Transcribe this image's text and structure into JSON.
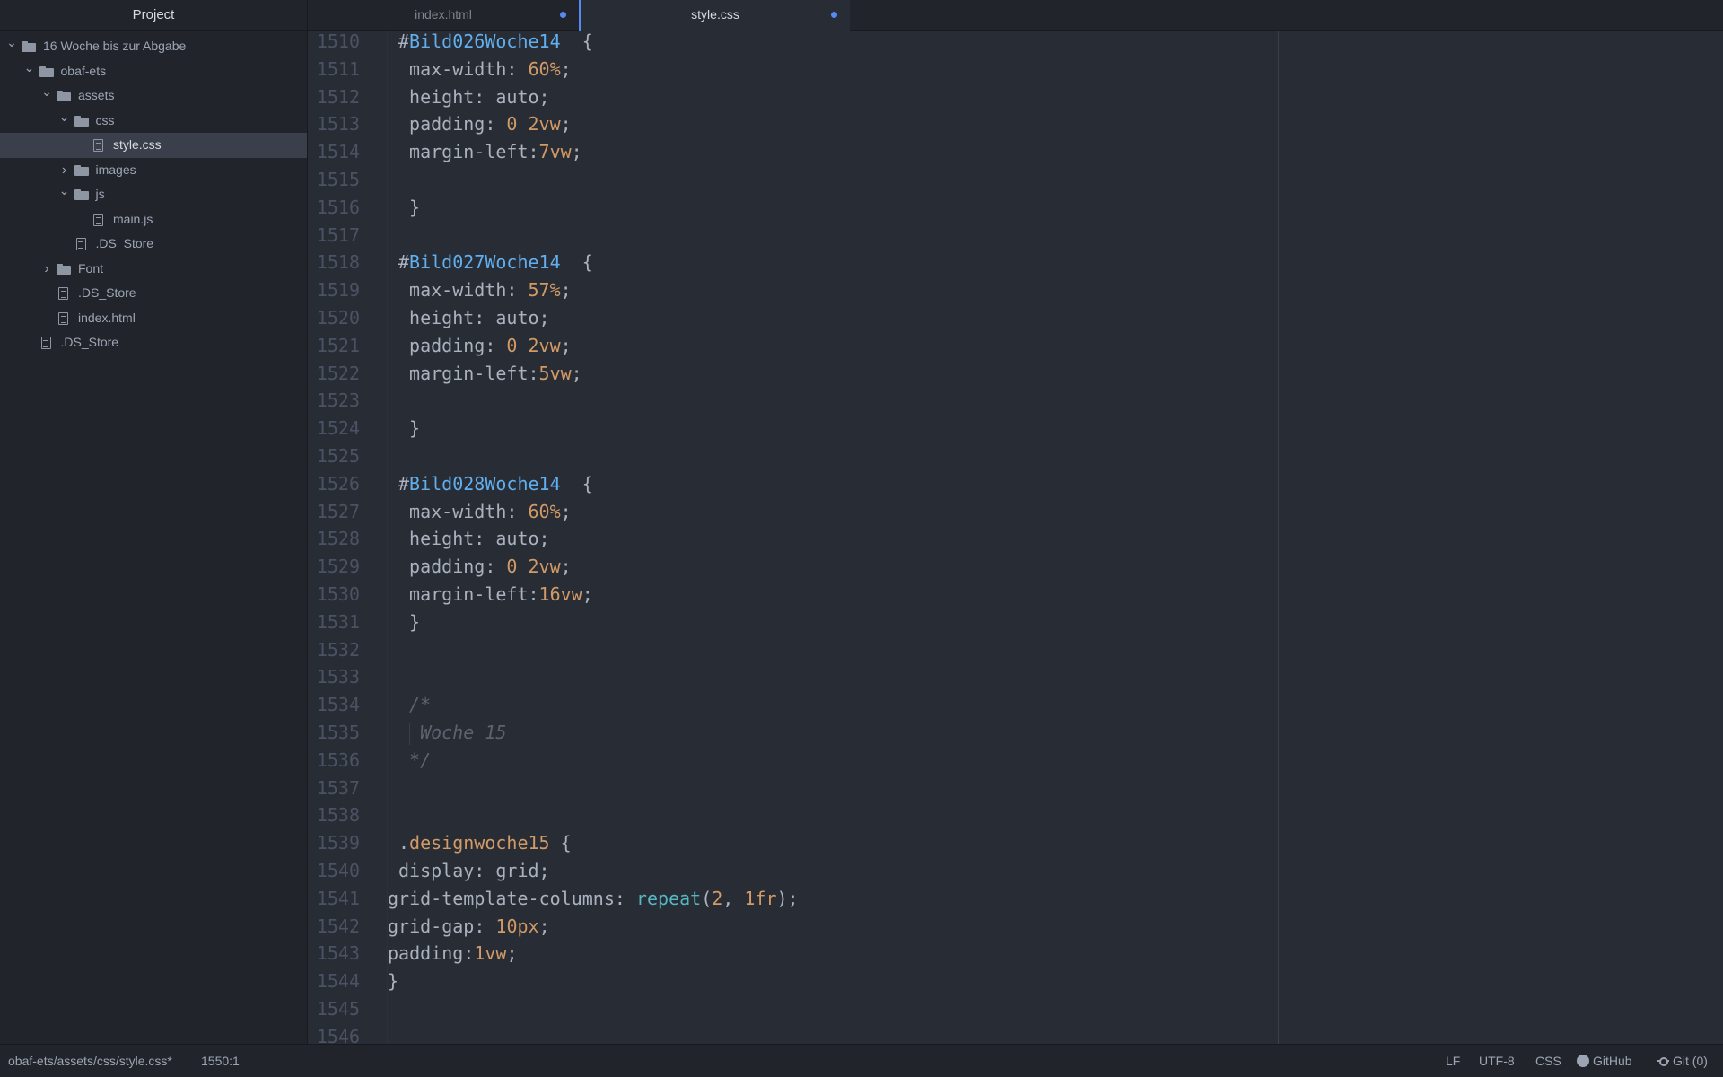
{
  "sidebar": {
    "title": "Project",
    "items": [
      {
        "label": "16 Woche bis zur Abgabe",
        "kind": "folder",
        "expanded": true,
        "depth": 0
      },
      {
        "label": "obaf-ets",
        "kind": "folder",
        "expanded": true,
        "depth": 1
      },
      {
        "label": "assets",
        "kind": "folder",
        "expanded": true,
        "depth": 2
      },
      {
        "label": "css",
        "kind": "folder",
        "expanded": true,
        "depth": 3
      },
      {
        "label": "style.css",
        "kind": "file",
        "depth": 4,
        "selected": true
      },
      {
        "label": "images",
        "kind": "folder",
        "expanded": false,
        "depth": 3
      },
      {
        "label": "js",
        "kind": "folder",
        "expanded": true,
        "depth": 3
      },
      {
        "label": "main.js",
        "kind": "file",
        "depth": 4
      },
      {
        "label": ".DS_Store",
        "kind": "file",
        "depth": 3
      },
      {
        "label": "Font",
        "kind": "folder",
        "expanded": false,
        "depth": 2
      },
      {
        "label": ".DS_Store",
        "kind": "file",
        "depth": 2
      },
      {
        "label": "index.html",
        "kind": "file",
        "depth": 2
      },
      {
        "label": ".DS_Store",
        "kind": "file",
        "depth": 1
      }
    ]
  },
  "tabs": [
    {
      "label": "index.html",
      "modified": true,
      "active": false
    },
    {
      "label": "style.css",
      "modified": true,
      "active": true
    }
  ],
  "editor": {
    "lines": [
      {
        "n": "1510",
        "tokens": [
          [
            "hash",
            "#"
          ],
          [
            "id",
            "Bild026Woche14"
          ],
          [
            "plain",
            "  {"
          ]
        ]
      },
      {
        "n": "1511",
        "tokens": [
          [
            "plain",
            " max-width: "
          ],
          [
            "num",
            "60%"
          ],
          [
            "plain",
            ";"
          ]
        ]
      },
      {
        "n": "1512",
        "tokens": [
          [
            "plain",
            " height: auto;"
          ]
        ]
      },
      {
        "n": "1513",
        "tokens": [
          [
            "plain",
            " padding: "
          ],
          [
            "num",
            "0"
          ],
          [
            "plain",
            " "
          ],
          [
            "num",
            "2vw"
          ],
          [
            "plain",
            ";"
          ]
        ]
      },
      {
        "n": "1514",
        "tokens": [
          [
            "plain",
            " margin-left:"
          ],
          [
            "num",
            "7vw"
          ],
          [
            "plain",
            ";"
          ]
        ]
      },
      {
        "n": "1515",
        "tokens": []
      },
      {
        "n": "1516",
        "tokens": [
          [
            "plain",
            " }"
          ]
        ]
      },
      {
        "n": "1517",
        "tokens": []
      },
      {
        "n": "1518",
        "tokens": [
          [
            "hash",
            "#"
          ],
          [
            "id",
            "Bild027Woche14"
          ],
          [
            "plain",
            "  {"
          ]
        ]
      },
      {
        "n": "1519",
        "tokens": [
          [
            "plain",
            " max-width: "
          ],
          [
            "num",
            "57%"
          ],
          [
            "plain",
            ";"
          ]
        ]
      },
      {
        "n": "1520",
        "tokens": [
          [
            "plain",
            " height: auto;"
          ]
        ]
      },
      {
        "n": "1521",
        "tokens": [
          [
            "plain",
            " padding: "
          ],
          [
            "num",
            "0"
          ],
          [
            "plain",
            " "
          ],
          [
            "num",
            "2vw"
          ],
          [
            "plain",
            ";"
          ]
        ]
      },
      {
        "n": "1522",
        "tokens": [
          [
            "plain",
            " margin-left:"
          ],
          [
            "num",
            "5vw"
          ],
          [
            "plain",
            ";"
          ]
        ]
      },
      {
        "n": "1523",
        "tokens": []
      },
      {
        "n": "1524",
        "tokens": [
          [
            "plain",
            " }"
          ]
        ]
      },
      {
        "n": "1525",
        "tokens": []
      },
      {
        "n": "1526",
        "tokens": [
          [
            "hash",
            "#"
          ],
          [
            "id",
            "Bild028Woche14"
          ],
          [
            "plain",
            "  {"
          ]
        ]
      },
      {
        "n": "1527",
        "tokens": [
          [
            "plain",
            " max-width: "
          ],
          [
            "num",
            "60%"
          ],
          [
            "plain",
            ";"
          ]
        ]
      },
      {
        "n": "1528",
        "tokens": [
          [
            "plain",
            " height: auto;"
          ]
        ]
      },
      {
        "n": "1529",
        "tokens": [
          [
            "plain",
            " padding: "
          ],
          [
            "num",
            "0"
          ],
          [
            "plain",
            " "
          ],
          [
            "num",
            "2vw"
          ],
          [
            "plain",
            ";"
          ]
        ]
      },
      {
        "n": "1530",
        "tokens": [
          [
            "plain",
            " margin-left:"
          ],
          [
            "num",
            "16vw"
          ],
          [
            "plain",
            ";"
          ]
        ]
      },
      {
        "n": "1531",
        "tokens": [
          [
            "plain",
            " }"
          ]
        ]
      },
      {
        "n": "1532",
        "tokens": []
      },
      {
        "n": "1533",
        "tokens": []
      },
      {
        "n": "1534",
        "tokens": [
          [
            "com",
            " /*"
          ]
        ]
      },
      {
        "n": "1535",
        "tokens": [
          [
            "com",
            "  Woche 15"
          ]
        ]
      },
      {
        "n": "1536",
        "tokens": [
          [
            "com",
            " */"
          ]
        ]
      },
      {
        "n": "1537",
        "tokens": []
      },
      {
        "n": "1538",
        "tokens": []
      },
      {
        "n": "1539",
        "tokens": [
          [
            "plain",
            "."
          ],
          [
            "cls",
            "designwoche15"
          ],
          [
            "plain",
            " {"
          ]
        ]
      },
      {
        "n": "1540",
        "tokens": [
          [
            "plain",
            "display: grid;"
          ]
        ]
      },
      {
        "n": "1541",
        "tokens": [
          [
            "plain",
            "grid-template-columns: "
          ],
          [
            "fn",
            "repeat"
          ],
          [
            "plain",
            "("
          ],
          [
            "num",
            "2"
          ],
          [
            "plain",
            ", "
          ],
          [
            "num",
            "1fr"
          ],
          [
            "plain",
            ");"
          ]
        ]
      },
      {
        "n": "1542",
        "tokens": [
          [
            "plain",
            "grid-gap: "
          ],
          [
            "num",
            "10px"
          ],
          [
            "plain",
            ";"
          ]
        ]
      },
      {
        "n": "1543",
        "tokens": [
          [
            "plain",
            "padding:"
          ],
          [
            "num",
            "1vw"
          ],
          [
            "plain",
            ";"
          ]
        ]
      },
      {
        "n": "1544",
        "tokens": [
          [
            "plain",
            "}"
          ]
        ]
      },
      {
        "n": "1545",
        "tokens": []
      },
      {
        "n": "1546",
        "tokens": []
      }
    ]
  },
  "statusbar": {
    "path": "obaf-ets/assets/css/style.css*",
    "cursor": "1550:1",
    "line_ending": "LF",
    "encoding": "UTF-8",
    "grammar": "CSS",
    "github": "GitHub",
    "git": "Git (0)"
  },
  "colors": {
    "accent": "#568af2",
    "background": "#282c34",
    "sidebar": "#21252b"
  }
}
